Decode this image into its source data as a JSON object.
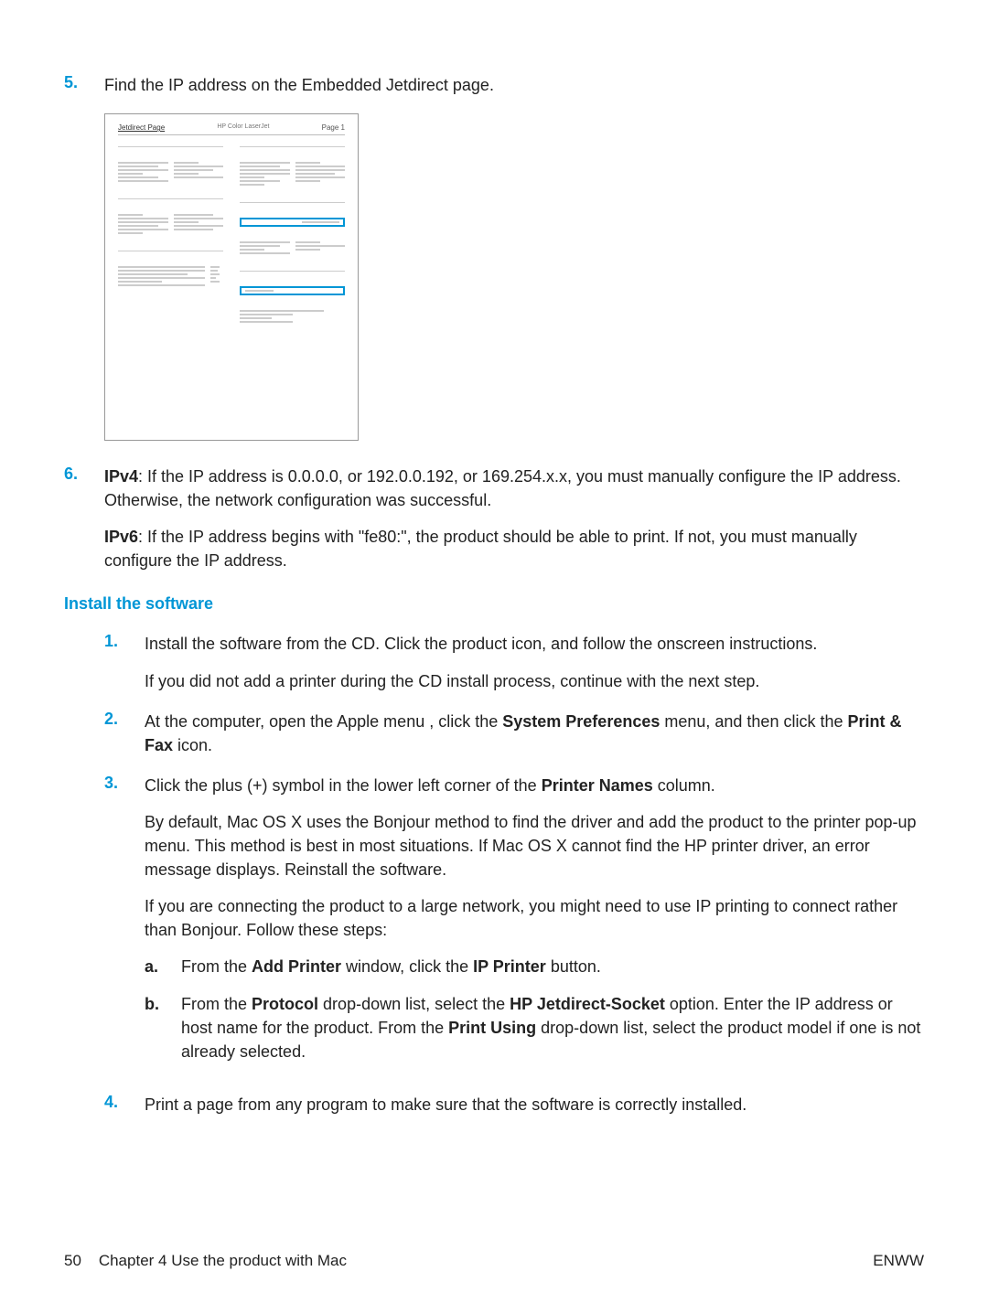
{
  "steps_before": [
    {
      "num": "5.",
      "paragraphs": [
        {
          "text": "Find the IP address on the Embedded Jetdirect page."
        }
      ]
    }
  ],
  "figure": {
    "title": "Jetdirect Page",
    "center_label": "HP Color LaserJet",
    "corner_label": "Page 1"
  },
  "step6": {
    "num": "6.",
    "ipv4_label": "IPv4",
    "ipv4_text": ": If the IP address is 0.0.0.0, or 192.0.0.192, or 169.254.x.x, you must manually configure the IP address. Otherwise, the network configuration was successful.",
    "ipv6_label": "IPv6",
    "ipv6_text": ": If the IP address begins with \"fe80:\", the product should be able to print. If not, you must manually configure the IP address."
  },
  "h3": "Install the software",
  "install_steps": [
    {
      "num": "1.",
      "paragraphs": [
        {
          "text": "Install the software from the CD. Click the product icon, and follow the onscreen instructions."
        },
        {
          "text": "If you did not add a printer during the CD install process, continue with the next step."
        }
      ]
    },
    {
      "num": "2.",
      "rich": {
        "pre": "At the computer, open the Apple menu ",
        "icon": "",
        "mid": ", click the ",
        "bold1": "System Preferences",
        "mid2": " menu, and then click the ",
        "bold2": "Print & Fax",
        "post": " icon."
      }
    },
    {
      "num": "3.",
      "rich3": {
        "pre": "Click the plus (+) symbol in the lower left corner of the ",
        "bold": "Printer Names",
        "post": " column."
      },
      "paragraphs": [
        {
          "text": "By default, Mac OS X uses the Bonjour method to find the driver and add the product to the printer pop-up menu. This method is best in most situations. If Mac OS X cannot find the HP printer driver, an error message displays. Reinstall the software."
        },
        {
          "text": "If you are connecting the product to a large network, you might need to use IP printing to connect rather than Bonjour. Follow these steps:"
        }
      ],
      "sub": [
        {
          "num": "a.",
          "rich": {
            "pre": "From the ",
            "bold1": "Add Printer",
            "mid": " window, click the ",
            "bold2": "IP Printer",
            "post": " button."
          }
        },
        {
          "num": "b.",
          "rich": {
            "pre": "From the ",
            "bold1": "Protocol",
            "mid": " drop-down list, select the ",
            "bold2": "HP Jetdirect-Socket",
            "mid2": " option. Enter the IP address or host name for the product. From the ",
            "bold3": "Print Using",
            "post": " drop-down list, select the product model if one is not already selected."
          }
        }
      ]
    },
    {
      "num": "4.",
      "paragraphs": [
        {
          "text": "Print a page from any program to make sure that the software is correctly installed."
        }
      ]
    }
  ],
  "footer": {
    "page_num": "50",
    "chapter": "Chapter 4   Use the product with Mac",
    "brand": "ENWW"
  }
}
